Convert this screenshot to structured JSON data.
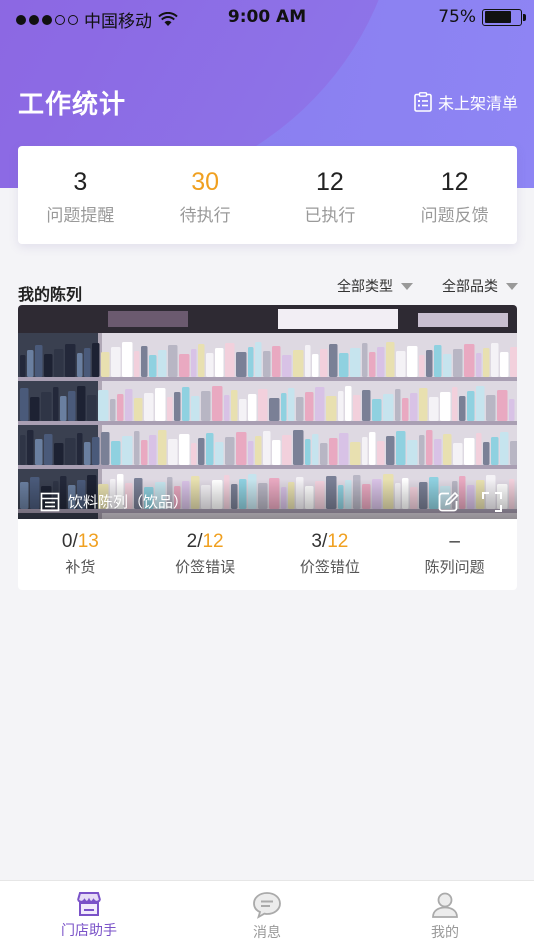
{
  "status_bar": {
    "carrier": "中国移动",
    "time": "9:00 AM",
    "battery": "75%",
    "battery_level": 0.75
  },
  "header": {
    "title": "工作统计",
    "unshelved_label": "未上架清单"
  },
  "stats": [
    {
      "value": "3",
      "label": "问题提醒",
      "highlight": false
    },
    {
      "value": "30",
      "label": "待执行",
      "highlight": true
    },
    {
      "value": "12",
      "label": "已执行",
      "highlight": false
    },
    {
      "value": "12",
      "label": "问题反馈",
      "highlight": false
    }
  ],
  "display_section": {
    "title": "我的陈列",
    "filters": {
      "type_label": "全部类型",
      "category_label": "全部品类"
    }
  },
  "shelf_card": {
    "name": "饮料陈列（饮品）",
    "counts": [
      {
        "done": "0",
        "total": "13",
        "label": "补货"
      },
      {
        "done": "2",
        "total": "12",
        "label": "价签错误"
      },
      {
        "done": "3",
        "total": "12",
        "label": "价签错位"
      },
      {
        "done": "–",
        "total": "",
        "label": "陈列问题"
      }
    ]
  },
  "tabs": [
    {
      "label": "门店助手",
      "active": true,
      "icon": "store-icon"
    },
    {
      "label": "消息",
      "active": false,
      "icon": "message-icon"
    },
    {
      "label": "我的",
      "active": false,
      "icon": "user-icon"
    }
  ],
  "colors": {
    "accent": "#7a52c8",
    "highlight": "#f0a020",
    "header_start": "#8a5fdc",
    "header_end": "#8e85f4"
  }
}
